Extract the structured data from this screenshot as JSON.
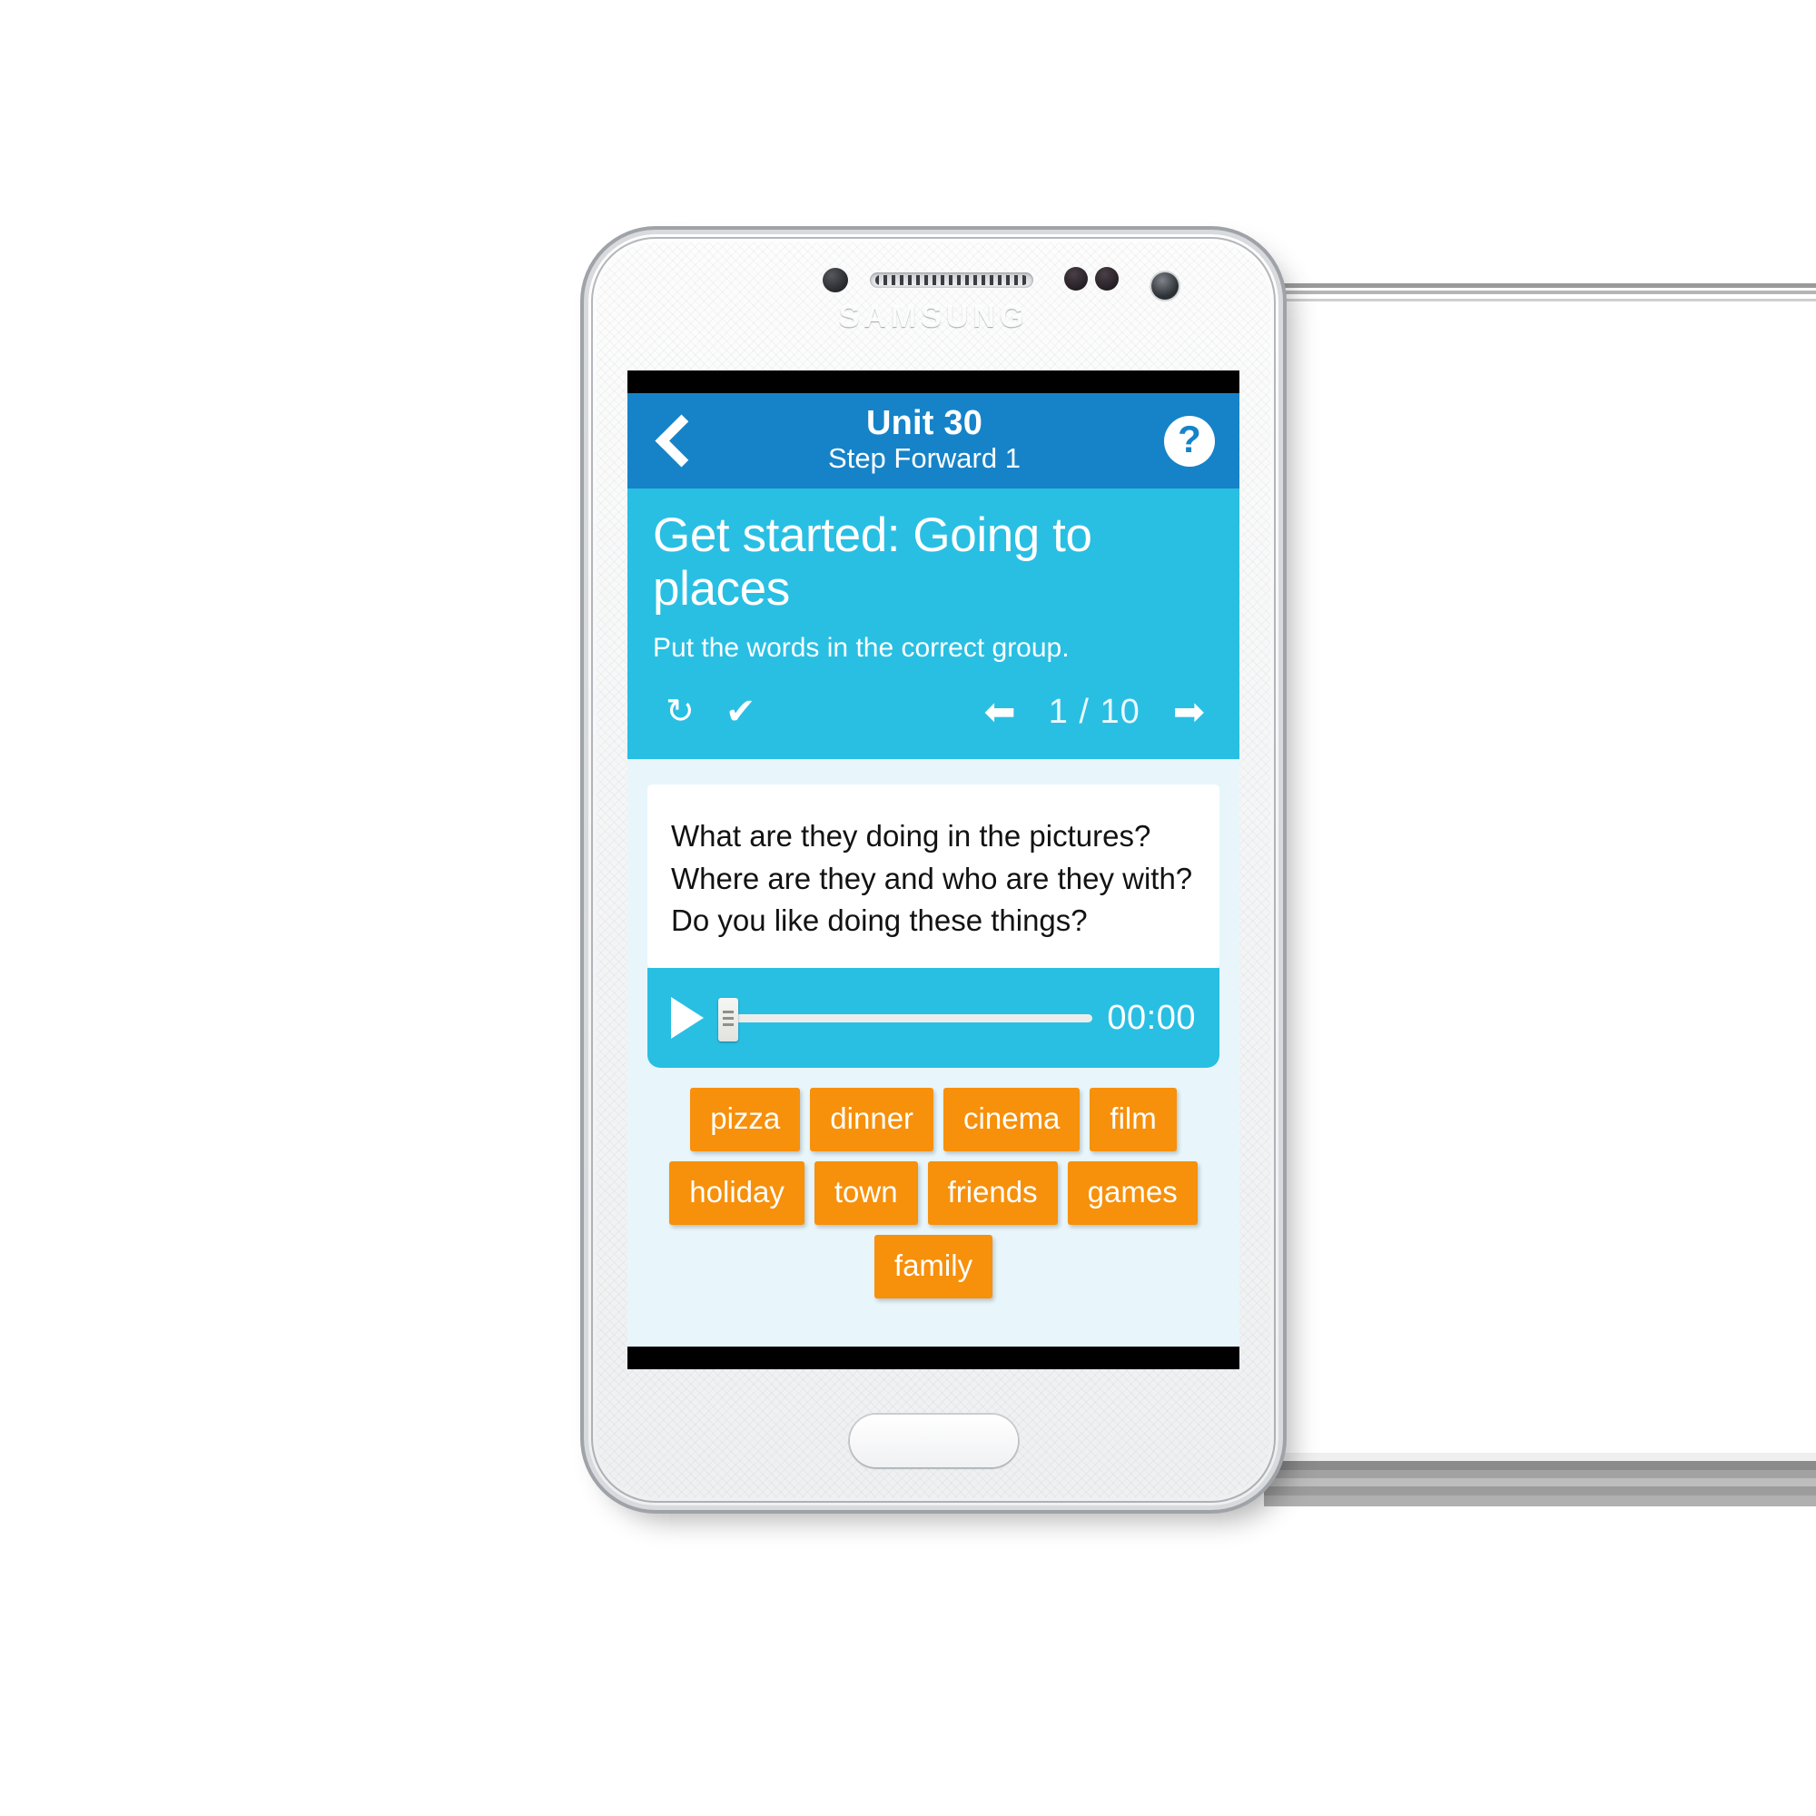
{
  "device": {
    "brand": "SAMSUNG"
  },
  "navbar": {
    "back_icon": "chevron-left-icon",
    "title": "Unit 30",
    "subtitle": "Step Forward 1",
    "help_label": "?",
    "background_color": "#1683c8"
  },
  "hero": {
    "title": "Get started: Going to places",
    "instruction": "Put the words in the correct group.",
    "background_color": "#29bfe3",
    "toolbar": {
      "refresh_icon": "refresh-icon",
      "refresh_glyph": "↻",
      "check_icon": "check-icon",
      "check_glyph": "✔",
      "prev_icon": "arrow-left-icon",
      "prev_glyph": "⬅",
      "next_icon": "arrow-right-icon",
      "next_glyph": "➡",
      "counter": "1 / 10"
    }
  },
  "question_card": {
    "lines": [
      "What are they doing in the pictures?",
      "Where are they and who are they with?",
      "Do you like doing these things?"
    ]
  },
  "player": {
    "play_icon": "play-icon",
    "time": "00:00",
    "progress_percent": 0,
    "background_color": "#29bfe3"
  },
  "word_chips": {
    "color": "#f7900b",
    "rows": [
      [
        "pizza",
        "dinner",
        "cinema",
        "film"
      ],
      [
        "holiday",
        "town",
        "friends",
        "games"
      ],
      [
        "family"
      ]
    ]
  }
}
